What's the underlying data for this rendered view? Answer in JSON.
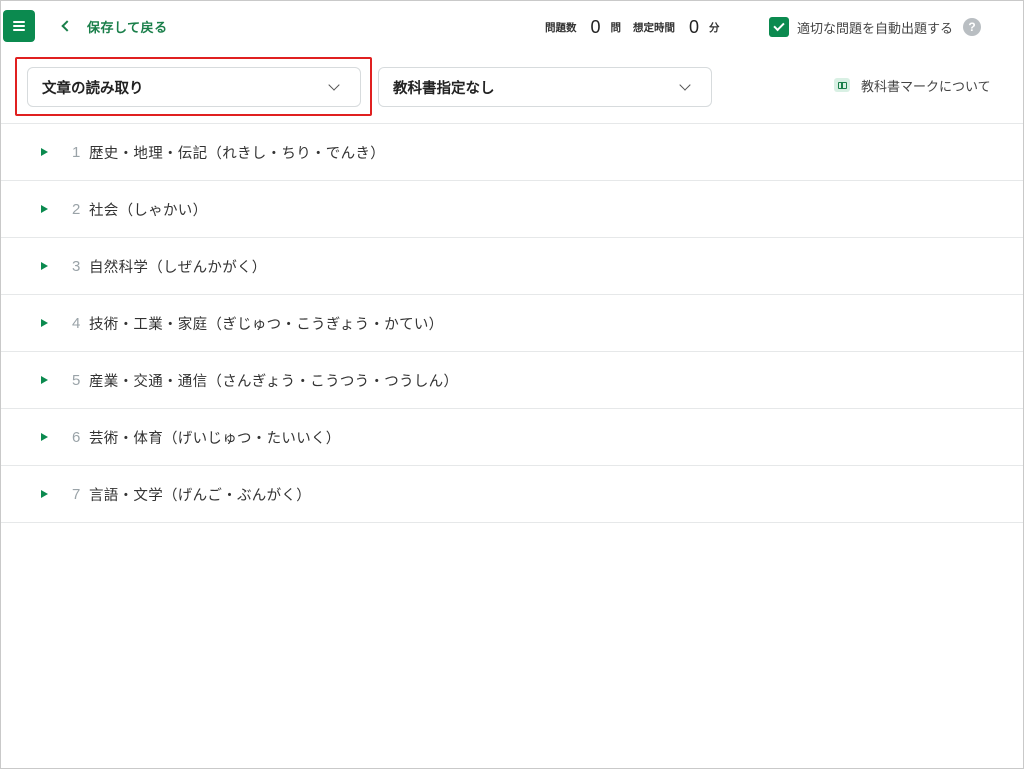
{
  "header": {
    "back_label": "保存して戻る",
    "question_count_label": "問題数",
    "question_count": "0",
    "question_unit": "問",
    "time_label": "想定時間",
    "time_value": "0",
    "time_unit": "分",
    "auto_select_label": "適切な問題を自動出題する",
    "auto_select_checked": true,
    "help_symbol": "?"
  },
  "filters": {
    "category_select": "文章の読み取り",
    "textbook_select": "教科書指定なし",
    "textbook_mark_link": "教科書マークについて"
  },
  "colors": {
    "accent": "#0b8a4f",
    "highlight_border": "#e02020"
  },
  "topics": [
    {
      "number": "1",
      "label": "歴史・地理・伝記（れきし・ちり・でんき）"
    },
    {
      "number": "2",
      "label": "社会（しゃかい）"
    },
    {
      "number": "3",
      "label": "自然科学（しぜんかがく）"
    },
    {
      "number": "4",
      "label": "技術・工業・家庭（ぎじゅつ・こうぎょう・かてい）"
    },
    {
      "number": "5",
      "label": "産業・交通・通信（さんぎょう・こうつう・つうしん）"
    },
    {
      "number": "6",
      "label": "芸術・体育（げいじゅつ・たいいく）"
    },
    {
      "number": "7",
      "label": "言語・文学（げんご・ぶんがく）"
    }
  ]
}
